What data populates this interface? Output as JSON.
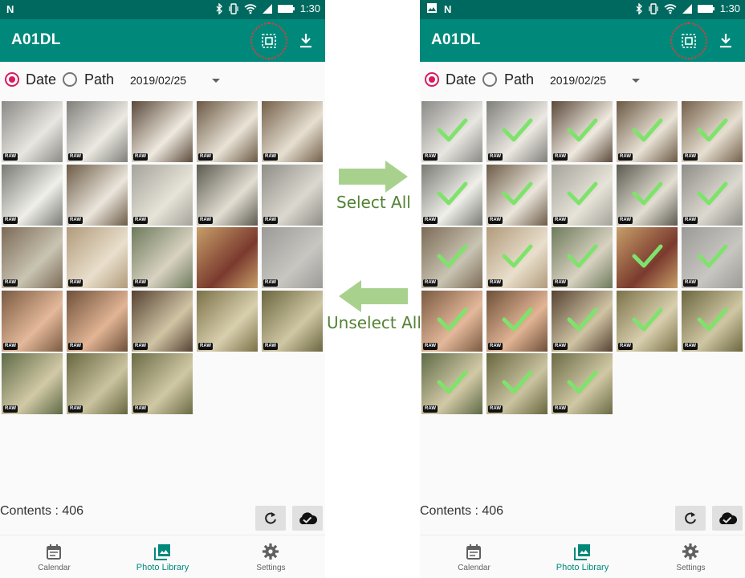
{
  "status_bar": {
    "time": "1:30"
  },
  "app_bar": {
    "title": "A01DL"
  },
  "filter": {
    "date_label": "Date",
    "path_label": "Path",
    "selected_mode": "Date",
    "date_value": "2019/02/25"
  },
  "grid": {
    "thumbnails": [
      {
        "subject": "soft-serve ice cream",
        "raw": true,
        "colors": [
          "#8a8a86",
          "#e8e6e0"
        ]
      },
      {
        "subject": "soft-serve ice cream",
        "raw": true,
        "colors": [
          "#7f7f7a",
          "#ece9e2"
        ]
      },
      {
        "subject": "ice cream and figure",
        "raw": true,
        "colors": [
          "#5a4a3a",
          "#efe9df"
        ]
      },
      {
        "subject": "ice cream and figure",
        "raw": true,
        "colors": [
          "#6b5844",
          "#e9e3d6"
        ]
      },
      {
        "subject": "ice cream and figure",
        "raw": true,
        "colors": [
          "#74604a",
          "#e6dfd1"
        ]
      },
      {
        "subject": "ice cream close-up",
        "raw": true,
        "colors": [
          "#777a73",
          "#f0efea"
        ]
      },
      {
        "subject": "ice cream and figure",
        "raw": true,
        "colors": [
          "#6c5b46",
          "#ebe6dc"
        ]
      },
      {
        "subject": "ice cream cone",
        "raw": true,
        "colors": [
          "#a4a39a",
          "#e6e3d8"
        ]
      },
      {
        "subject": "ice cream cone",
        "raw": true,
        "colors": [
          "#5c5a50",
          "#e2ded2"
        ]
      },
      {
        "subject": "ice cream cone",
        "raw": true,
        "colors": [
          "#8e8d86",
          "#dbd8cf"
        ]
      },
      {
        "subject": "figure on table",
        "raw": true,
        "colors": [
          "#7b6a55",
          "#c9c4b2"
        ]
      },
      {
        "subject": "figure on table",
        "raw": true,
        "colors": [
          "#b09a7a",
          "#e9dfcc"
        ]
      },
      {
        "subject": "figure on table",
        "raw": true,
        "colors": [
          "#6d7a5b",
          "#d8d2c1"
        ]
      },
      {
        "subject": "wooden chest",
        "raw": false,
        "colors": [
          "#c79f6a",
          "#7a3a2e"
        ]
      },
      {
        "subject": "paper document",
        "raw": true,
        "colors": [
          "#9b9a96",
          "#c8c6c1"
        ]
      },
      {
        "subject": "seafood dish",
        "raw": true,
        "colors": [
          "#7a5a40",
          "#e4b89a"
        ]
      },
      {
        "subject": "seafood dish",
        "raw": true,
        "colors": [
          "#6e5039",
          "#e1b494"
        ]
      },
      {
        "subject": "seafood dish",
        "raw": true,
        "colors": [
          "#564232",
          "#cfc4a4"
        ]
      },
      {
        "subject": "table with dishes",
        "raw": true,
        "colors": [
          "#7b7148",
          "#d8cfae"
        ]
      },
      {
        "subject": "table with dishes",
        "raw": true,
        "colors": [
          "#6b6640",
          "#cfc7a3"
        ]
      },
      {
        "subject": "table with dishes",
        "raw": true,
        "colors": [
          "#5e6a46",
          "#d2c9a6"
        ]
      },
      {
        "subject": "table with dishes",
        "raw": true,
        "colors": [
          "#67663f",
          "#cac3a0"
        ]
      },
      {
        "subject": "table with dishes",
        "raw": true,
        "colors": [
          "#6a6b45",
          "#d0c8a4"
        ]
      }
    ]
  },
  "footer": {
    "contents_label": "Contents : 406"
  },
  "bottom_nav": {
    "items": [
      {
        "label": "Calendar",
        "icon": "calendar-icon",
        "active": false
      },
      {
        "label": "Photo Library",
        "icon": "photo-library-icon",
        "active": true
      },
      {
        "label": "Settings",
        "icon": "gear-icon",
        "active": false
      }
    ]
  },
  "annotations": {
    "select_all": "Select All",
    "unselect_all": "Unselect All"
  },
  "colors": {
    "status_bar": "#00695f",
    "app_bar": "#00897b",
    "radio_checked": "#d81b60",
    "accent_nav": "#00897b",
    "check_mark": "#7ee36b",
    "arrow": "#a9d18e",
    "annotation_text": "#548235",
    "highlight_circle": "#e53935"
  },
  "screens": [
    {
      "id": "before",
      "selected": false
    },
    {
      "id": "after",
      "selected": true
    }
  ]
}
